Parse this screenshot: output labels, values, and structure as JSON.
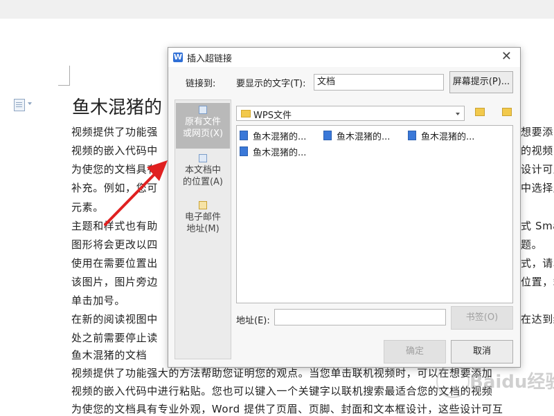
{
  "document": {
    "heading": "鱼木混猪的",
    "lines": [
      "视频提供了功能强",
      "视频的嵌入代码中",
      "为使您的文档具有",
      "补充。例如，您可",
      "元素。",
      "主题和样式也有助",
      "图形将会更改以四",
      "使用在需要位置出",
      "该图片，图片旁边",
      "单击加号。",
      "在新的阅读视图中",
      "处之前需要停止读",
      "鱼木混猪的文档",
      "视频提供了功能强大的方法帮助您证明您的观点。当您单击联机视频时，可以在想要添加",
      "视频的嵌入代码中进行粘贴。您也可以键入一个关键字以联机搜索最适合您的文档的视频",
      "为使您的文档具有专业外观，Word 提供了页眉、页脚、封面和文本框设计，这些设计可互"
    ],
    "right_fragments": [
      "想要添",
      "的视频",
      "设计可互",
      "中选择用",
      "式 Smar",
      "题。",
      "式，请单",
      "位置，箱",
      "在达到结"
    ]
  },
  "watermark": "Baidu经验",
  "dialog": {
    "title": "插入超链接",
    "close_label": "✕",
    "link_to_label": "链接到:",
    "display_text_label": "要显示的文字(T):",
    "display_text_value": "文档",
    "screen_tip_button": "屏幕提示(P)...",
    "sidebar": [
      {
        "label": "原有文件\n或网页(X)",
        "selected": true
      },
      {
        "label": "本文档中\n的位置(A)",
        "selected": false
      },
      {
        "label": "电子邮件\n地址(M)",
        "selected": false
      }
    ],
    "folder_name": "WPS文件",
    "files": [
      "鱼木混猪的...",
      "鱼木混猪的...",
      "鱼木混猪的...",
      "鱼木混猪的..."
    ],
    "address_label": "地址(E):",
    "address_value": "",
    "bookmark_button": "书签(O)",
    "ok_button": "确定",
    "cancel_button": "取消"
  },
  "colors": {
    "accent": "#2f6fd6",
    "arrow": "#e02020",
    "selected_nav": "#b9b9b9"
  }
}
